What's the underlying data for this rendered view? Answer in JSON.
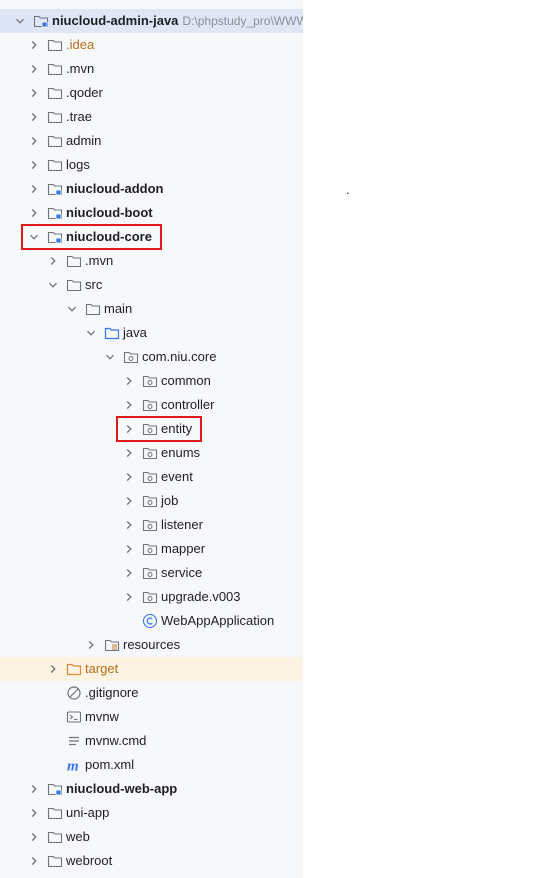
{
  "tree": {
    "root": {
      "label": "niucloud-admin-java",
      "path": "D:\\phpstudy_pro\\WWW"
    },
    "items": [
      {
        "label": ".idea",
        "depth": 1,
        "arrow": "right",
        "icon": "folder-icon",
        "style": "orange"
      },
      {
        "label": ".mvn",
        "depth": 1,
        "arrow": "right",
        "icon": "folder-icon"
      },
      {
        "label": ".qoder",
        "depth": 1,
        "arrow": "right",
        "icon": "folder-icon"
      },
      {
        "label": ".trae",
        "depth": 1,
        "arrow": "right",
        "icon": "folder-icon"
      },
      {
        "label": "admin",
        "depth": 1,
        "arrow": "right",
        "icon": "folder-icon"
      },
      {
        "label": "logs",
        "depth": 1,
        "arrow": "right",
        "icon": "folder-icon"
      },
      {
        "label": "niucloud-addon",
        "depth": 1,
        "arrow": "right",
        "icon": "module-icon",
        "style": "bold"
      },
      {
        "label": "niucloud-boot",
        "depth": 1,
        "arrow": "right",
        "icon": "module-icon",
        "style": "bold"
      },
      {
        "label": "niucloud-core",
        "depth": 1,
        "arrow": "down",
        "icon": "module-icon",
        "style": "bold",
        "highlight": true
      },
      {
        "label": ".mvn",
        "depth": 2,
        "arrow": "right",
        "icon": "folder-icon"
      },
      {
        "label": "src",
        "depth": 2,
        "arrow": "down",
        "icon": "folder-icon"
      },
      {
        "label": "main",
        "depth": 3,
        "arrow": "down",
        "icon": "folder-icon"
      },
      {
        "label": "java",
        "depth": 4,
        "arrow": "down",
        "icon": "source-folder-icon"
      },
      {
        "label": "com.niu.core",
        "depth": 5,
        "arrow": "down",
        "icon": "package-icon"
      },
      {
        "label": "common",
        "depth": 6,
        "arrow": "right",
        "icon": "package-icon"
      },
      {
        "label": "controller",
        "depth": 6,
        "arrow": "right",
        "icon": "package-icon"
      },
      {
        "label": "entity",
        "depth": 6,
        "arrow": "right",
        "icon": "package-icon",
        "highlight": true
      },
      {
        "label": "enums",
        "depth": 6,
        "arrow": "right",
        "icon": "package-icon"
      },
      {
        "label": "event",
        "depth": 6,
        "arrow": "right",
        "icon": "package-icon"
      },
      {
        "label": "job",
        "depth": 6,
        "arrow": "right",
        "icon": "package-icon"
      },
      {
        "label": "listener",
        "depth": 6,
        "arrow": "right",
        "icon": "package-icon"
      },
      {
        "label": "mapper",
        "depth": 6,
        "arrow": "right",
        "icon": "package-icon"
      },
      {
        "label": "service",
        "depth": 6,
        "arrow": "right",
        "icon": "package-icon"
      },
      {
        "label": "upgrade.v003",
        "depth": 6,
        "arrow": "right",
        "icon": "package-icon"
      },
      {
        "label": "WebAppApplication",
        "depth": 6,
        "arrow": "none",
        "icon": "java-class-icon"
      },
      {
        "label": "resources",
        "depth": 4,
        "arrow": "right",
        "icon": "resources-folder-icon"
      },
      {
        "label": "target",
        "depth": 2,
        "arrow": "right",
        "icon": "excluded-folder-icon",
        "style": "orange",
        "excluded": true
      },
      {
        "label": ".gitignore",
        "depth": 2,
        "arrow": "none",
        "icon": "ignore-file-icon"
      },
      {
        "label": "mvnw",
        "depth": 2,
        "arrow": "none",
        "icon": "shell-script-icon"
      },
      {
        "label": "mvnw.cmd",
        "depth": 2,
        "arrow": "none",
        "icon": "text-file-icon"
      },
      {
        "label": "pom.xml",
        "depth": 2,
        "arrow": "none",
        "icon": "maven-icon"
      },
      {
        "label": "niucloud-web-app",
        "depth": 1,
        "arrow": "right",
        "icon": "module-icon",
        "style": "bold"
      },
      {
        "label": "uni-app",
        "depth": 1,
        "arrow": "right",
        "icon": "folder-icon"
      },
      {
        "label": "web",
        "depth": 1,
        "arrow": "right",
        "icon": "folder-icon"
      },
      {
        "label": "webroot",
        "depth": 1,
        "arrow": "right",
        "icon": "folder-icon"
      }
    ]
  },
  "stray_mark": ".",
  "colors": {
    "highlight_box": "#e0191b",
    "excluded_text": "#b96e17",
    "source_folder": "#3574f0",
    "maven": "#3574f0"
  }
}
